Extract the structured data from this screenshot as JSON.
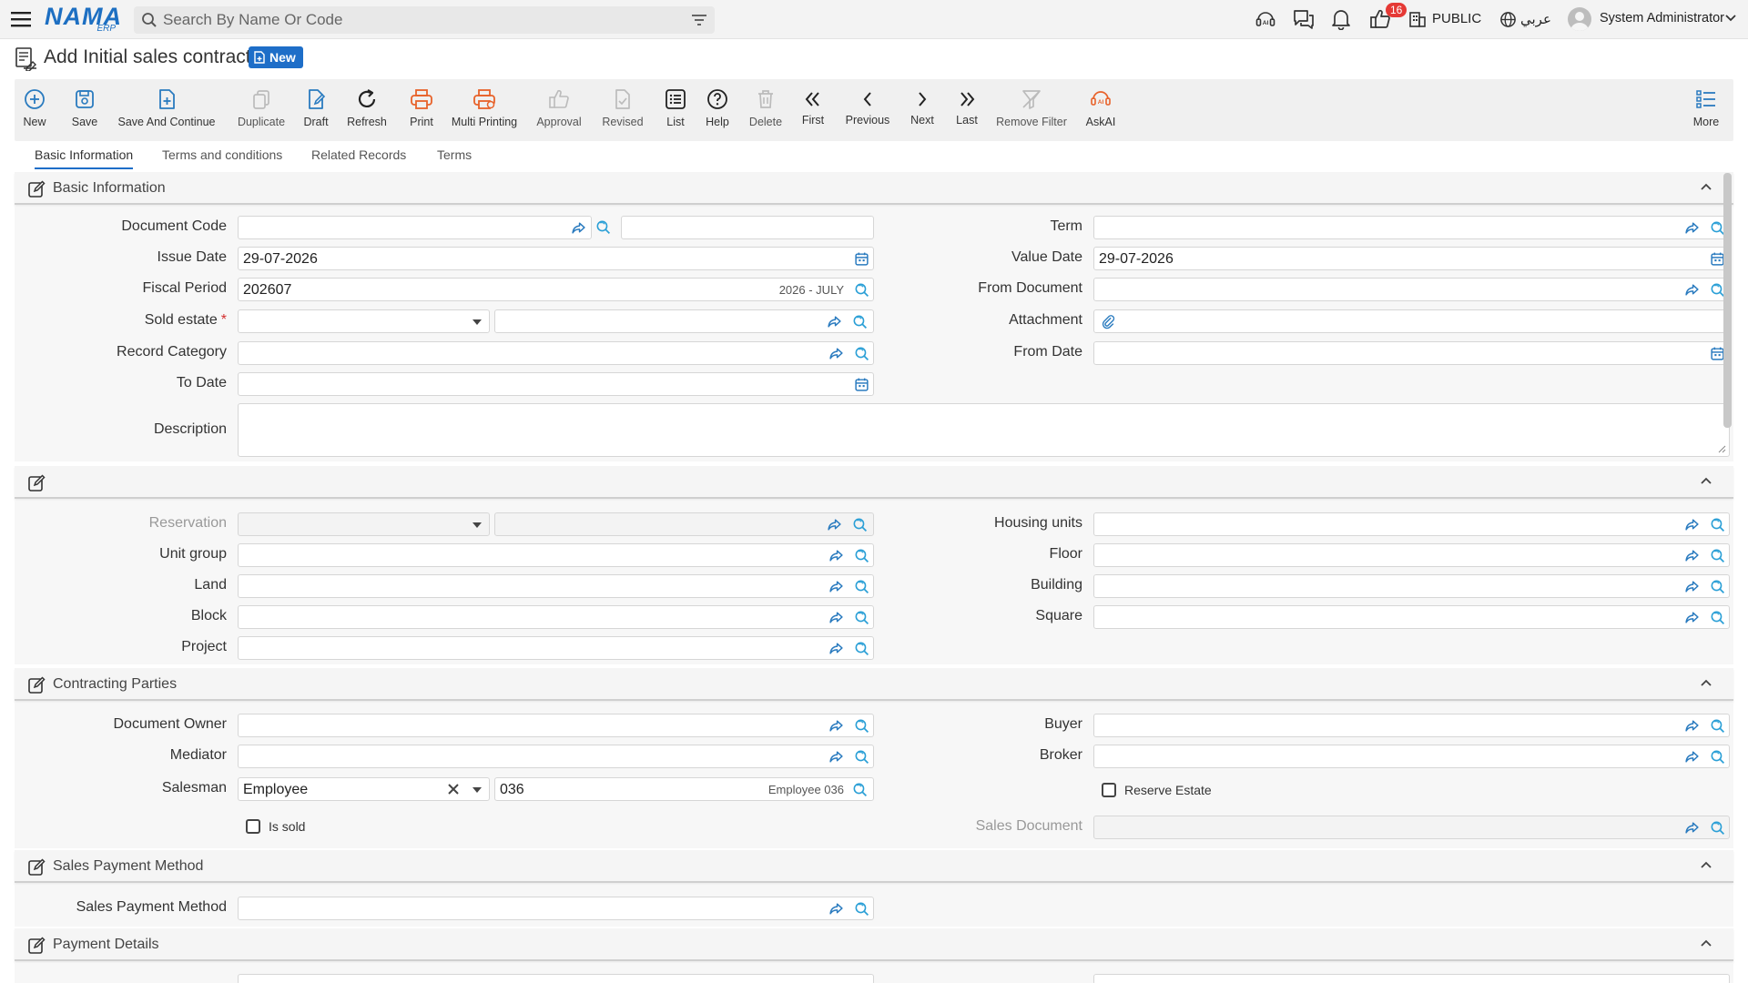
{
  "topbar": {
    "logo_main": "NAMA",
    "logo_sub": "ERP",
    "search_placeholder": "Search By Name Or Code",
    "notification_count": "16",
    "public_label": "PUBLIC",
    "language_label": "عربي",
    "user_name": "System Administrator",
    "icons": [
      "menu-icon",
      "search-icon",
      "filter-icon",
      "ai-support-icon",
      "chat-icon",
      "bell-icon",
      "thumbs-up-icon",
      "building-icon",
      "globe-icon",
      "user-avatar-icon",
      "chevron-down-icon"
    ]
  },
  "page": {
    "title": "Add Initial sales contract",
    "status_badge": "New"
  },
  "toolbar": {
    "buttons": [
      {
        "label": "New",
        "icon": "plus-circle-icon"
      },
      {
        "label": "Save",
        "icon": "save-icon"
      },
      {
        "label": "Save And Continue",
        "icon": "save-continue-icon"
      },
      {
        "label": "Duplicate",
        "icon": "duplicate-icon"
      },
      {
        "label": "Draft",
        "icon": "draft-icon"
      },
      {
        "label": "Refresh",
        "icon": "refresh-icon"
      },
      {
        "label": "Print",
        "icon": "print-icon"
      },
      {
        "label": "Multi Printing",
        "icon": "multi-print-icon"
      },
      {
        "label": "Approval",
        "icon": "approval-icon"
      },
      {
        "label": "Revised",
        "icon": "revised-icon"
      },
      {
        "label": "List",
        "icon": "list-icon"
      },
      {
        "label": "Help",
        "icon": "help-icon"
      },
      {
        "label": "Delete",
        "icon": "delete-icon"
      },
      {
        "label": "First",
        "icon": "first-icon"
      },
      {
        "label": "Previous",
        "icon": "previous-icon"
      },
      {
        "label": "Next",
        "icon": "next-icon"
      },
      {
        "label": "Last",
        "icon": "last-icon"
      },
      {
        "label": "Remove Filter",
        "icon": "remove-filter-icon"
      },
      {
        "label": "AskAI",
        "icon": "ask-ai-icon"
      },
      {
        "label": "More",
        "icon": "more-icon"
      }
    ]
  },
  "tabs": [
    "Basic Information",
    "Terms and conditions",
    "Related Records",
    "Terms"
  ],
  "sections": {
    "basic": {
      "title": "Basic Information",
      "labels": {
        "document_code": "Document Code",
        "issue_date": "Issue Date",
        "fiscal_period": "Fiscal Period",
        "sold_estate": "Sold estate",
        "record_category": "Record Category",
        "to_date": "To Date",
        "description": "Description",
        "term": "Term",
        "value_date": "Value Date",
        "from_document": "From Document",
        "attachment": "Attachment",
        "from_date": "From Date"
      },
      "values": {
        "issue_date": "29-07-2026",
        "fiscal_period": "202607",
        "fiscal_period_hint": "2026 - JULY",
        "value_date": "29-07-2026"
      },
      "required_mark": "*"
    },
    "units": {
      "title": "",
      "labels": {
        "reservation": "Reservation",
        "unit_group": "Unit group",
        "land": "Land",
        "block": "Block",
        "project": "Project",
        "housing_units": "Housing units",
        "floor": "Floor",
        "building": "Building",
        "square": "Square"
      }
    },
    "parties": {
      "title": "Contracting Parties",
      "labels": {
        "document_owner": "Document Owner",
        "mediator": "Mediator",
        "salesman": "Salesman",
        "is_sold": "Is sold",
        "buyer": "Buyer",
        "broker": "Broker",
        "reserve_estate": "Reserve Estate",
        "sales_document": "Sales Document"
      },
      "values": {
        "salesman_type": "Employee",
        "salesman_code": "036",
        "salesman_hint": "Employee 036",
        "is_sold": false,
        "reserve_estate": false
      }
    },
    "payment_method": {
      "title": "Sales Payment Method",
      "labels": {
        "sales_payment_method": "Sales Payment Method"
      }
    },
    "payment_details": {
      "title": "Payment Details"
    }
  },
  "colors": {
    "accent": "#1e6ec8",
    "icon_blue": "#2a7bbf",
    "icon_orange": "#e8622a",
    "badge_red": "#e53935"
  }
}
